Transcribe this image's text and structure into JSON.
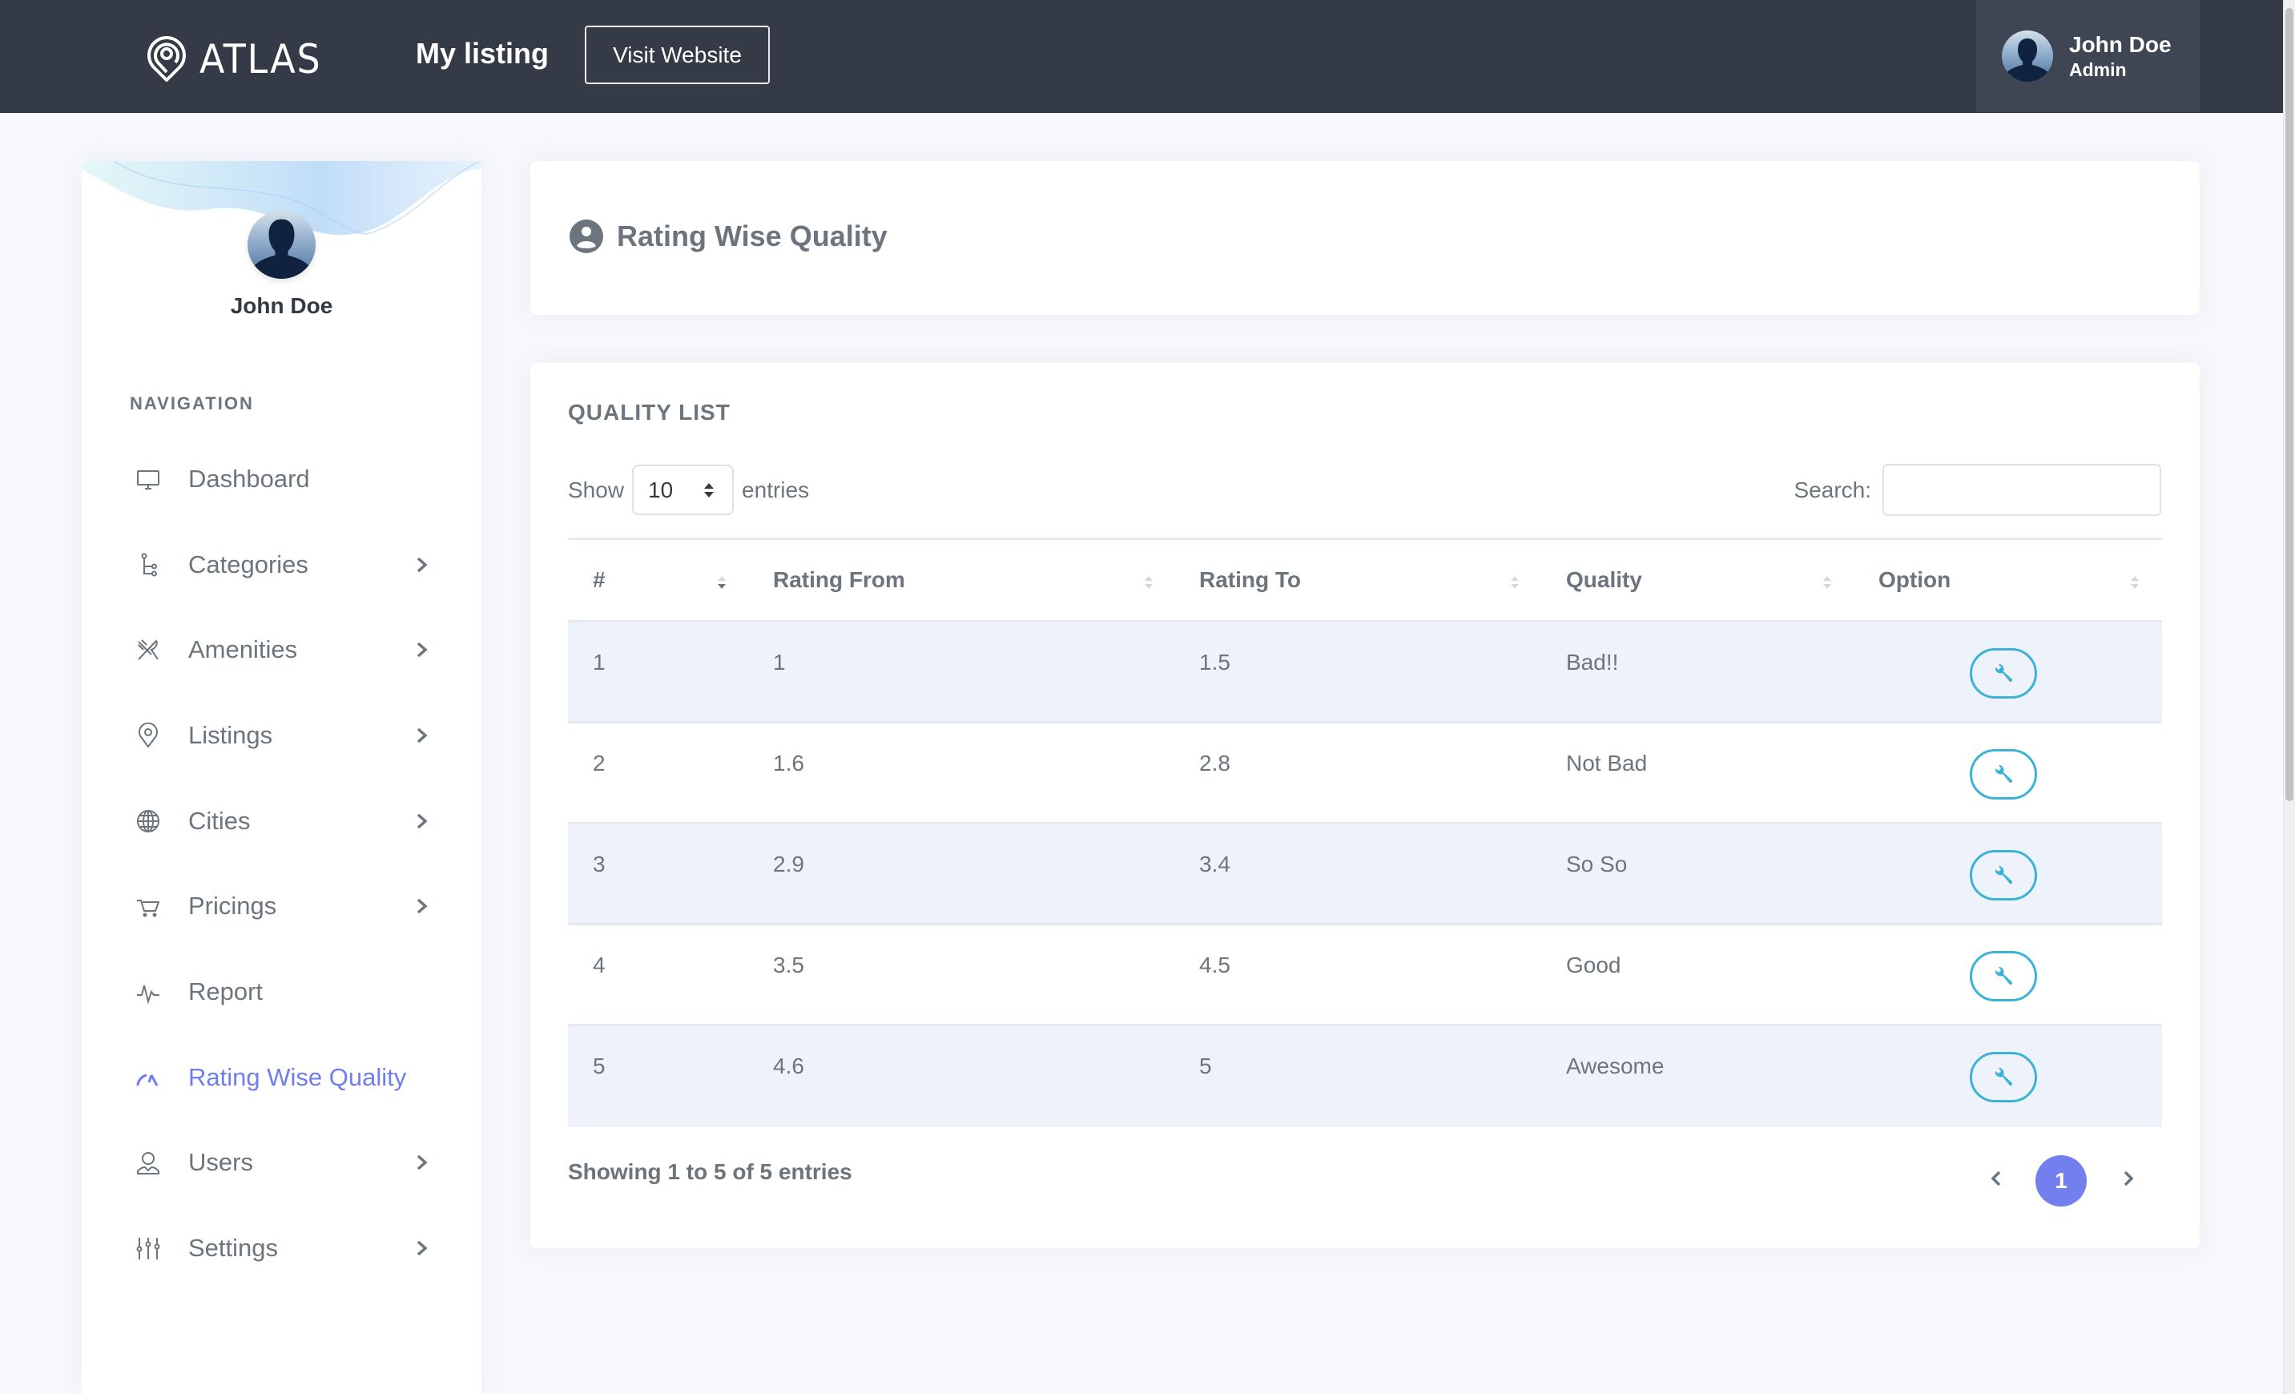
{
  "header": {
    "logo_text": "ATLAS",
    "logo_icon": "map-pin-icon",
    "title": "My listing",
    "visit_website_label": "Visit Website",
    "user": {
      "name": "John Doe",
      "role": "Admin",
      "avatar_icon": "user-silhouette-icon"
    }
  },
  "sidebar": {
    "user_name": "John Doe",
    "nav_heading": "NAVIGATION",
    "items": [
      {
        "label": "Dashboard",
        "icon": "monitor-icon",
        "has_submenu": false,
        "active": false
      },
      {
        "label": "Categories",
        "icon": "hierarchy-icon",
        "has_submenu": true,
        "active": false
      },
      {
        "label": "Amenities",
        "icon": "fork-knife-icon",
        "has_submenu": true,
        "active": false
      },
      {
        "label": "Listings",
        "icon": "map-pin-icon",
        "has_submenu": true,
        "active": false
      },
      {
        "label": "Cities",
        "icon": "globe-icon",
        "has_submenu": true,
        "active": false
      },
      {
        "label": "Pricings",
        "icon": "cart-icon",
        "has_submenu": true,
        "active": false
      },
      {
        "label": "Report",
        "icon": "pulse-icon",
        "has_submenu": false,
        "active": false
      },
      {
        "label": "Rating Wise Quality",
        "icon": "speedometer-icon",
        "has_submenu": false,
        "active": true
      },
      {
        "label": "Users",
        "icon": "user-icon",
        "has_submenu": true,
        "active": false
      },
      {
        "label": "Settings",
        "icon": "sliders-icon",
        "has_submenu": true,
        "active": false
      }
    ]
  },
  "page": {
    "title": "Rating Wise Quality",
    "title_icon": "user-circle-icon"
  },
  "quality_list": {
    "section_title": "QUALITY LIST",
    "length": {
      "prefix": "Show",
      "value": "10",
      "suffix": "entries"
    },
    "search": {
      "label": "Search:",
      "value": "",
      "placeholder": ""
    },
    "columns": [
      {
        "label": "#",
        "sort": "desc"
      },
      {
        "label": "Rating From",
        "sort": "none"
      },
      {
        "label": "Rating To",
        "sort": "none"
      },
      {
        "label": "Quality",
        "sort": "none"
      },
      {
        "label": "Option",
        "sort": "none"
      }
    ],
    "rows": [
      {
        "num": "1",
        "rating_from": "1",
        "rating_to": "1.5",
        "quality": "Bad!!",
        "option_icon": "wrench-icon"
      },
      {
        "num": "2",
        "rating_from": "1.6",
        "rating_to": "2.8",
        "quality": "Not Bad",
        "option_icon": "wrench-icon"
      },
      {
        "num": "3",
        "rating_from": "2.9",
        "rating_to": "3.4",
        "quality": "So So",
        "option_icon": "wrench-icon"
      },
      {
        "num": "4",
        "rating_from": "3.5",
        "rating_to": "4.5",
        "quality": "Good",
        "option_icon": "wrench-icon"
      },
      {
        "num": "5",
        "rating_from": "4.6",
        "rating_to": "5",
        "quality": "Awesome",
        "option_icon": "wrench-icon"
      }
    ],
    "info": "Showing 1 to 5 of 5 entries",
    "pagination": {
      "prev_icon": "chevron-left-icon",
      "current_page": "1",
      "next_icon": "chevron-right-icon"
    }
  },
  "colors": {
    "header_bg": "#343a46",
    "user_box_bg": "#3e4553",
    "accent": "#737fef",
    "option_button": "#3bb2d6",
    "row_striped": "#eef2fa",
    "text_muted": "#6c757d"
  }
}
